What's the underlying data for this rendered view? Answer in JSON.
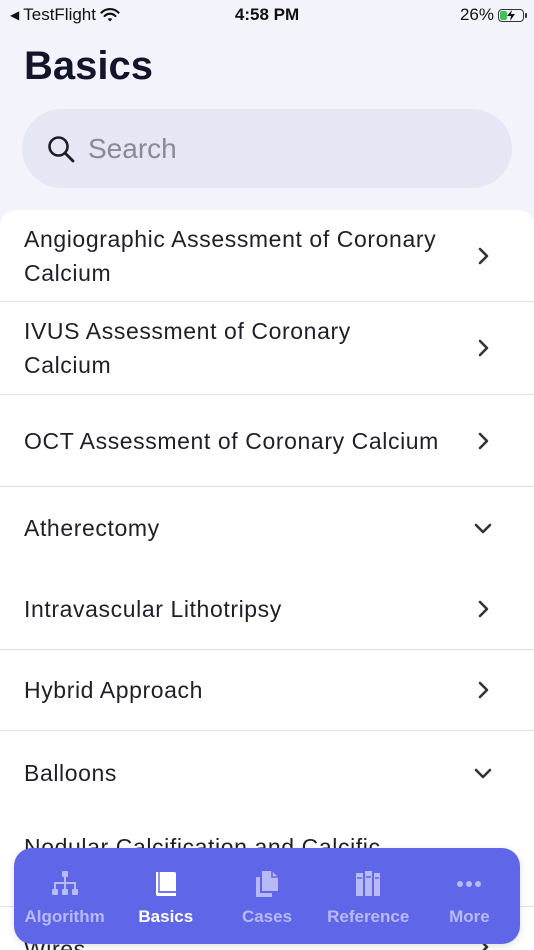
{
  "status_bar": {
    "back_app": "TestFlight",
    "time": "4:58 PM",
    "battery": "26%"
  },
  "page": {
    "title": "Basics"
  },
  "search": {
    "placeholder": "Search",
    "value": ""
  },
  "list": {
    "items": [
      {
        "label": "Angiographic Assessment of Coronary Calcium",
        "indicator": "chevron-right"
      },
      {
        "label": "IVUS Assessment of Coronary Calcium",
        "indicator": "chevron-right"
      },
      {
        "label": "OCT Assessment of Coronary Calcium",
        "indicator": "chevron-right"
      },
      {
        "label": "Atherectomy",
        "indicator": "chevron-down"
      },
      {
        "label": "Intravascular Lithotripsy",
        "indicator": "chevron-right"
      },
      {
        "label": "Hybrid Approach",
        "indicator": "chevron-right"
      },
      {
        "label": "Balloons",
        "indicator": "chevron-down"
      },
      {
        "label": "Nodular Calcification and Calcific",
        "indicator": "none"
      },
      {
        "label": "Wires",
        "indicator": "chevron-right"
      }
    ]
  },
  "tab_bar": {
    "tabs": [
      {
        "label": "Algorithm",
        "icon": "hierarchy-icon",
        "active": false
      },
      {
        "label": "Basics",
        "icon": "book-icon",
        "active": true
      },
      {
        "label": "Cases",
        "icon": "documents-icon",
        "active": false
      },
      {
        "label": "Reference",
        "icon": "books-icon",
        "active": false
      },
      {
        "label": "More",
        "icon": "ellipsis-icon",
        "active": false
      }
    ]
  },
  "colors": {
    "accent": "#5f66e8",
    "background": "#f3f4fb",
    "search_bg": "#e5e7f4"
  }
}
